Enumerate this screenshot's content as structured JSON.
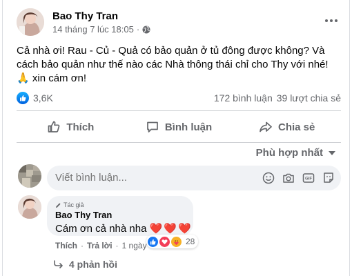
{
  "post": {
    "author": "Bao Thy Tran",
    "timestamp": "14 tháng 7 lúc 18:05",
    "separator": "·",
    "text_line1": "Cả nhà ơi! Rau - Củ - Quả có bảo quản ở tủ đông được không? Và",
    "text_line2": "cách bảo quản như thế nào các Nhà thông thái chỉ cho Thy với nhé!",
    "text_emoji": "🙏",
    "text_line3": "xin cám ơn!"
  },
  "stats": {
    "reactions": "3,6K",
    "comments": "172 bình luận",
    "shares": "39 lượt chia sẻ"
  },
  "actions": {
    "like": "Thích",
    "comment": "Bình luận",
    "share": "Chia sẻ"
  },
  "sort": {
    "label": "Phù hợp nhất"
  },
  "composer": {
    "placeholder": "Viết bình luận..."
  },
  "comment": {
    "badge": "Tác giả",
    "author": "Bao Thy Tran",
    "text": "Cám ơn cả nhà nha",
    "hearts": "❤️❤️❤️",
    "like": "Thích",
    "dot1": "·",
    "reply": "Trả lời",
    "dot2": "·",
    "time": "1 ngày",
    "reaction_count": "28"
  },
  "replies": {
    "label": "4 phản hồi"
  },
  "colors": {
    "like_blue": "#1877f2",
    "love_red": "#f33e58",
    "care_yellow": "#f7b125",
    "muted": "#65676b"
  },
  "icons": [
    "globe-icon",
    "more-icon",
    "like-icon",
    "comment-icon",
    "share-icon",
    "emoji-icon",
    "camera-icon",
    "gif-icon",
    "sticker-icon",
    "reply-arrow-icon",
    "pencil-icon"
  ]
}
